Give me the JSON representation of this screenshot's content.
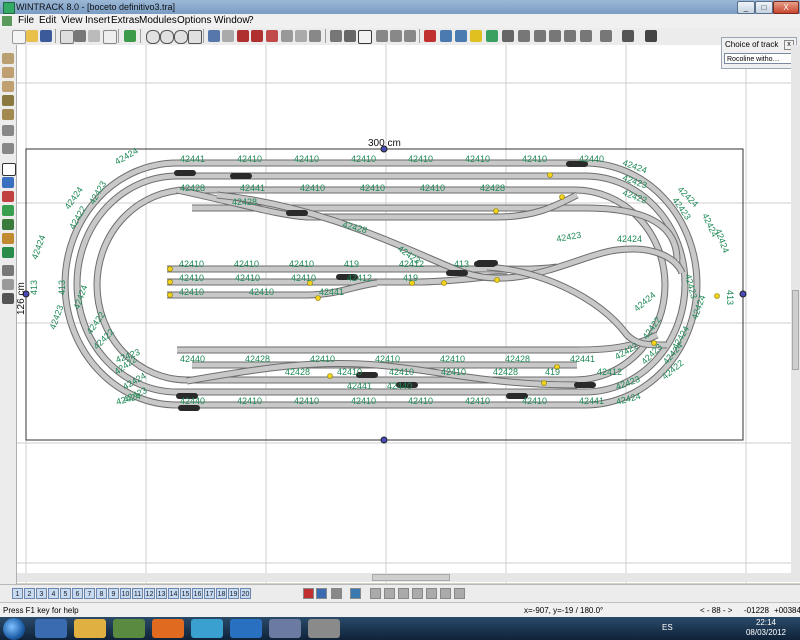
{
  "window": {
    "title": "WINTRACK 8.0 - [boceto definitivo3.tra]",
    "min_label": "_",
    "max_label": "□",
    "close_label": "X"
  },
  "menu": [
    {
      "label": "File"
    },
    {
      "label": "Edit"
    },
    {
      "label": "View"
    },
    {
      "label": "Insert"
    },
    {
      "label": "Extras"
    },
    {
      "label": "Modules"
    },
    {
      "label": "Options"
    },
    {
      "label": "Window"
    },
    {
      "label": "?"
    }
  ],
  "choice_of_track": {
    "title": "Choice of track",
    "close": "x",
    "selected": "Rocoline witho…"
  },
  "layout": {
    "width_label": "300 cm",
    "height_label": "126 cm",
    "track_labels": {
      "top_row": [
        "42441",
        "42410",
        "42410",
        "42410",
        "42410",
        "42410",
        "42410",
        "42440"
      ],
      "second_row": [
        "42428",
        "42441",
        "42410",
        "42410",
        "42410",
        "42428"
      ],
      "mid_row1": [
        "42410",
        "42410",
        "42410",
        "419",
        "42412",
        "413"
      ],
      "mid_row2": [
        "42410",
        "42410",
        "42410",
        "42412",
        "419"
      ],
      "mid_row3": [
        "42410",
        "42410",
        "42441"
      ],
      "lower_row1": [
        "42440",
        "42428",
        "42410",
        "42410",
        "42410",
        "42428",
        "42441"
      ],
      "lower_row2": [
        "42428",
        "42410",
        "42410",
        "42410",
        "42428",
        "419",
        "42412"
      ],
      "bottom_row1": [
        "42441",
        "42440"
      ],
      "bottom_row2": [
        "42440",
        "42410",
        "42410",
        "42410",
        "42410",
        "42410",
        "42410",
        "42441"
      ],
      "curves_left": [
        "42424",
        "42424",
        "42423",
        "42422",
        "42424",
        "413",
        "413",
        "42423",
        "42424",
        "42422",
        "42422",
        "42423",
        "42424",
        "42422",
        "42423",
        "42424"
      ],
      "curves_right": [
        "42424",
        "42423",
        "42422",
        "42424",
        "42423",
        "42424",
        "42424",
        "413",
        "42423",
        "42424",
        "42424",
        "42422",
        "42423",
        "42424",
        "42422",
        "42423",
        "42424"
      ],
      "diagonal": [
        "42428",
        "42428",
        "42423",
        "42423",
        "42424",
        "42424",
        "42422"
      ]
    }
  },
  "layers": [
    "1",
    "2",
    "3",
    "4",
    "5",
    "6",
    "7",
    "8",
    "9",
    "10",
    "11",
    "12",
    "13",
    "14",
    "15",
    "16",
    "17",
    "18",
    "19",
    "20"
  ],
  "status": {
    "help": "Press F1 key for help",
    "coords": "x=-907, y=-19 / 180.0°",
    "zoom": "< - 88 - >",
    "pos_x": "-01228",
    "pos_y": "+00384"
  },
  "taskbar": {
    "lang": "ES",
    "time": "22:14",
    "date": "08/03/2012"
  },
  "colors": {
    "track_fill": "#c8c8c8",
    "track_edge": "#6e6e6e",
    "label": "#1f8a57",
    "grid": "#cfcfcf",
    "board": "#333333",
    "handle": "#3b3bb0"
  }
}
